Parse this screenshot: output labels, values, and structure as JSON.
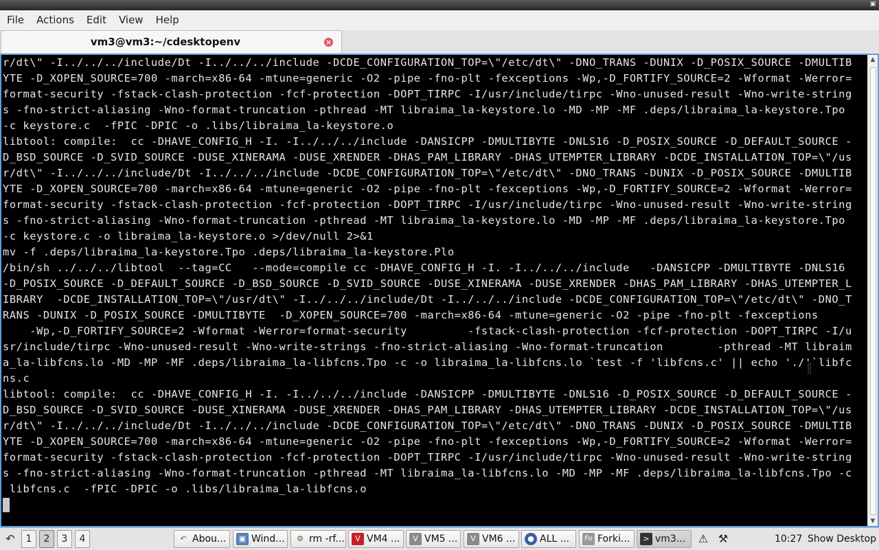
{
  "window": {
    "maximize_icon": "restore-icon"
  },
  "menubar": {
    "items": [
      "File",
      "Actions",
      "Edit",
      "View",
      "Help"
    ]
  },
  "tab": {
    "title": "vm3@vm3:~/cdesktopenv",
    "close_icon": "close-icon"
  },
  "terminal": {
    "lines": [
      "r/dt\\\" -I../../../include/Dt -I../../../include -DCDE_CONFIGURATION_TOP=\\\"/etc/dt\\\" -DNO_TRANS -DUNIX -D_POSIX_SOURCE -DMULTIB",
      "YTE -D_XOPEN_SOURCE=700 -march=x86-64 -mtune=generic -O2 -pipe -fno-plt -fexceptions -Wp,-D_FORTIFY_SOURCE=2 -Wformat -Werror=",
      "format-security -fstack-clash-protection -fcf-protection -DOPT_TIRPC -I/usr/include/tirpc -Wno-unused-result -Wno-write-string",
      "s -fno-strict-aliasing -Wno-format-truncation -pthread -MT libraima_la-keystore.lo -MD -MP -MF .deps/libraima_la-keystore.Tpo",
      "-c keystore.c  -fPIC -DPIC -o .libs/libraima_la-keystore.o",
      "libtool: compile:  cc -DHAVE_CONFIG_H -I. -I../../../include -DANSICPP -DMULTIBYTE -DNLS16 -D_POSIX_SOURCE -D_DEFAULT_SOURCE -",
      "D_BSD_SOURCE -D_SVID_SOURCE -DUSE_XINERAMA -DUSE_XRENDER -DHAS_PAM_LIBRARY -DHAS_UTEMPTER_LIBRARY -DCDE_INSTALLATION_TOP=\\\"/us",
      "r/dt\\\" -I../../../include/Dt -I../../../include -DCDE_CONFIGURATION_TOP=\\\"/etc/dt\\\" -DNO_TRANS -DUNIX -D_POSIX_SOURCE -DMULTIB",
      "YTE -D_XOPEN_SOURCE=700 -march=x86-64 -mtune=generic -O2 -pipe -fno-plt -fexceptions -Wp,-D_FORTIFY_SOURCE=2 -Wformat -Werror=",
      "format-security -fstack-clash-protection -fcf-protection -DOPT_TIRPC -I/usr/include/tirpc -Wno-unused-result -Wno-write-string",
      "s -fno-strict-aliasing -Wno-format-truncation -pthread -MT libraima_la-keystore.lo -MD -MP -MF .deps/libraima_la-keystore.Tpo",
      "-c keystore.c -o libraima_la-keystore.o >/dev/null 2>&1",
      "mv -f .deps/libraima_la-keystore.Tpo .deps/libraima_la-keystore.Plo",
      "/bin/sh ../../../libtool  --tag=CC   --mode=compile cc -DHAVE_CONFIG_H -I. -I../../../include   -DANSICPP -DMULTIBYTE -DNLS16",
      "-D_POSIX_SOURCE -D_DEFAULT_SOURCE -D_BSD_SOURCE -D_SVID_SOURCE -DUSE_XINERAMA -DUSE_XRENDER -DHAS_PAM_LIBRARY -DHAS_UTEMPTER_L",
      "IBRARY  -DCDE_INSTALLATION_TOP=\\\"/usr/dt\\\" -I../../../include/Dt -I../../../include -DCDE_CONFIGURATION_TOP=\\\"/etc/dt\\\" -DNO_T",
      "RANS -DUNIX -D_POSIX_SOURCE -DMULTIBYTE  -D_XOPEN_SOURCE=700 -march=x86-64 -mtune=generic -O2 -pipe -fno-plt -fexceptions",
      "    -Wp,-D_FORTIFY_SOURCE=2 -Wformat -Werror=format-security         -fstack-clash-protection -fcf-protection -DOPT_TIRPC -I/u",
      "sr/include/tirpc -Wno-unused-result -Wno-write-strings -fno-strict-aliasing -Wno-format-truncation        -pthread -MT libraim",
      "a_la-libfcns.lo -MD -MP -MF .deps/libraima_la-libfcns.Tpo -c -o libraima_la-libfcns.lo `test -f 'libfcns.c' || echo './'`libfc",
      "ns.c",
      "libtool: compile:  cc -DHAVE_CONFIG_H -I. -I../../../include -DANSICPP -DMULTIBYTE -DNLS16 -D_POSIX_SOURCE -D_DEFAULT_SOURCE -",
      "D_BSD_SOURCE -D_SVID_SOURCE -DUSE_XINERAMA -DUSE_XRENDER -DHAS_PAM_LIBRARY -DHAS_UTEMPTER_LIBRARY -DCDE_INSTALLATION_TOP=\\\"/us",
      "r/dt\\\" -I../../../include/Dt -I../../../include -DCDE_CONFIGURATION_TOP=\\\"/etc/dt\\\" -DNO_TRANS -DUNIX -D_POSIX_SOURCE -DMULTIB",
      "YTE -D_XOPEN_SOURCE=700 -march=x86-64 -mtune=generic -O2 -pipe -fno-plt -fexceptions -Wp,-D_FORTIFY_SOURCE=2 -Wformat -Werror=",
      "format-security -fstack-clash-protection -fcf-protection -DOPT_TIRPC -I/usr/include/tirpc -Wno-unused-result -Wno-write-string",
      "s -fno-strict-aliasing -Wno-format-truncation -pthread -MT libraima_la-libfcns.lo -MD -MP -MF .deps/libraima_la-libfcns.Tpo -c",
      " libfcns.c  -fPIC -DPIC -o .libs/libraima_la-libfcns.o"
    ],
    "colors": {
      "background": "#000000",
      "foreground": "#e6e6e6",
      "border": "#5aa0e0"
    }
  },
  "taskbar": {
    "desktops": [
      "1",
      "2",
      "3",
      "4"
    ],
    "active_desktop": "2",
    "tasks": [
      {
        "label": "Abou...",
        "icon": "help-icon"
      },
      {
        "label": "Wind...",
        "icon": "window-icon"
      },
      {
        "label": "rm -rf...",
        "icon": "terminal-icon"
      },
      {
        "label": "VM4 ...",
        "icon": "vm-icon"
      },
      {
        "label": "VM5 ...",
        "icon": "vm-icon"
      },
      {
        "label": "VM6 ...",
        "icon": "vm-icon"
      },
      {
        "label": "ALL ...",
        "icon": "browser-icon"
      },
      {
        "label": "Forki...",
        "icon": "fo-icon"
      },
      {
        "label": "vm3...",
        "icon": "terminal-icon"
      }
    ],
    "tray": {
      "notice_icon": "alert-icon",
      "tool_icon": "tool-icon"
    },
    "clock": "10:27",
    "show_desktop": "Show Desktop"
  }
}
